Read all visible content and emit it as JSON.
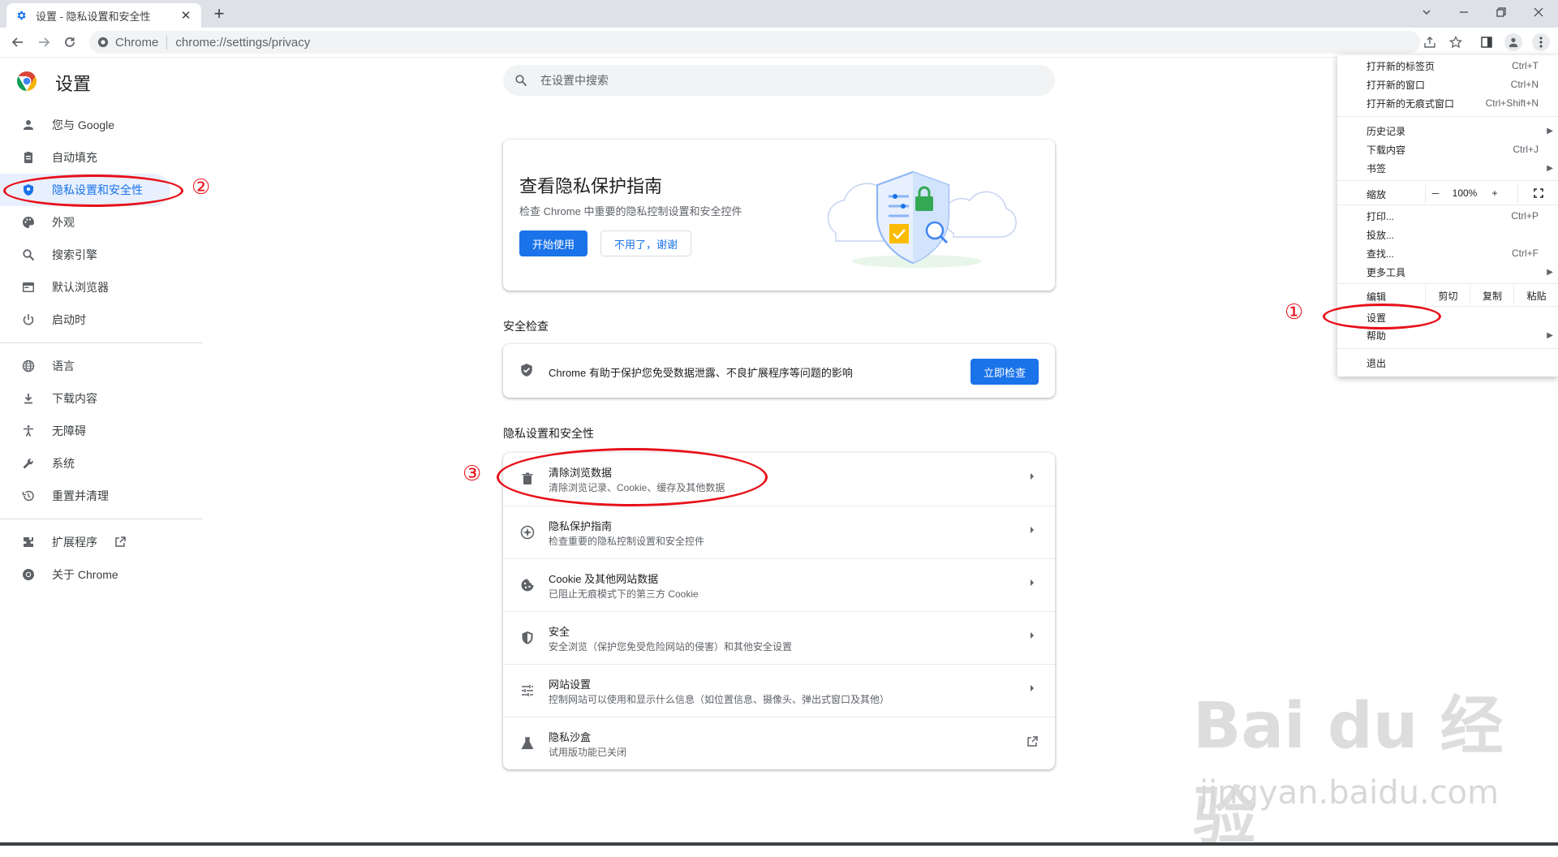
{
  "browser": {
    "tab_title": "设置 - 隐私设置和安全性",
    "tab_close": "✕",
    "new_tab": "+",
    "omnibox_chip": "Chrome",
    "omnibox_url": "chrome://settings/privacy"
  },
  "settings": {
    "title": "设置",
    "search_placeholder": "在设置中搜索",
    "nav": [
      {
        "label": "您与 Google",
        "icon": "person-icon"
      },
      {
        "label": "自动填充",
        "icon": "autofill-icon"
      },
      {
        "label": "隐私设置和安全性",
        "icon": "shield-icon",
        "active": true
      },
      {
        "label": "外观",
        "icon": "palette-icon"
      },
      {
        "label": "搜索引擎",
        "icon": "search-icon"
      },
      {
        "label": "默认浏览器",
        "icon": "browser-icon"
      },
      {
        "label": "启动时",
        "icon": "power-icon"
      },
      {
        "label": "语言",
        "icon": "globe-icon"
      },
      {
        "label": "下载内容",
        "icon": "download-icon"
      },
      {
        "label": "无障碍",
        "icon": "accessibility-icon"
      },
      {
        "label": "系统",
        "icon": "wrench-icon"
      },
      {
        "label": "重置并清理",
        "icon": "restore-icon"
      },
      {
        "label": "扩展程序",
        "icon": "puzzle-icon"
      },
      {
        "label": "关于 Chrome",
        "icon": "chrome-icon"
      }
    ],
    "guide_card": {
      "title": "查看隐私保护指南",
      "desc": "检查 Chrome 中重要的隐私控制设置和安全控件",
      "primary_button": "开始使用",
      "secondary_button": "不用了，谢谢"
    },
    "safety_check": {
      "heading": "安全检查",
      "text": "Chrome 有助于保护您免受数据泄露、不良扩展程序等问题的影响",
      "button": "立即检查"
    },
    "privacy": {
      "heading": "隐私设置和安全性",
      "rows": [
        {
          "title": "清除浏览数据",
          "subtitle": "清除浏览记录、Cookie、缓存及其他数据",
          "icon": "trash-icon"
        },
        {
          "title": "隐私保护指南",
          "subtitle": "检查重要的隐私控制设置和安全控件",
          "icon": "compass-icon"
        },
        {
          "title": "Cookie 及其他网站数据",
          "subtitle": "已阻止无痕模式下的第三方 Cookie",
          "icon": "cookie-icon"
        },
        {
          "title": "安全",
          "subtitle": "安全浏览（保护您免受危险网站的侵害）和其他安全设置",
          "icon": "security-shield-icon"
        },
        {
          "title": "网站设置",
          "subtitle": "控制网站可以使用和显示什么信息（如位置信息、摄像头、弹出式窗口及其他）",
          "icon": "tune-icon"
        },
        {
          "title": "隐私沙盒",
          "subtitle": "试用版功能已关闭",
          "icon": "flask-icon"
        }
      ]
    }
  },
  "menu": {
    "new_tab": "打开新的标签页",
    "new_tab_sc": "Ctrl+T",
    "new_window": "打开新的窗口",
    "new_window_sc": "Ctrl+N",
    "incognito": "打开新的无痕式窗口",
    "incognito_sc": "Ctrl+Shift+N",
    "history": "历史记录",
    "downloads": "下载内容",
    "downloads_sc": "Ctrl+J",
    "bookmarks": "书签",
    "zoom": "缩放",
    "zoom_minus": "－",
    "zoom_value": "100%",
    "zoom_plus": "+",
    "print": "打印...",
    "print_sc": "Ctrl+P",
    "cast": "投放...",
    "find": "查找...",
    "find_sc": "Ctrl+F",
    "more_tools": "更多工具",
    "edit": "编辑",
    "cut": "剪切",
    "copy": "复制",
    "paste": "粘贴",
    "settings": "设置",
    "help": "帮助",
    "exit": "退出"
  },
  "annotations": {
    "one": "①",
    "two": "②",
    "three": "③"
  },
  "watermark": {
    "brand": "Bai du 经验",
    "url": "jingyan.baidu.com"
  },
  "colors": {
    "accent": "#1a73e8",
    "annotation": "#e8101a"
  }
}
